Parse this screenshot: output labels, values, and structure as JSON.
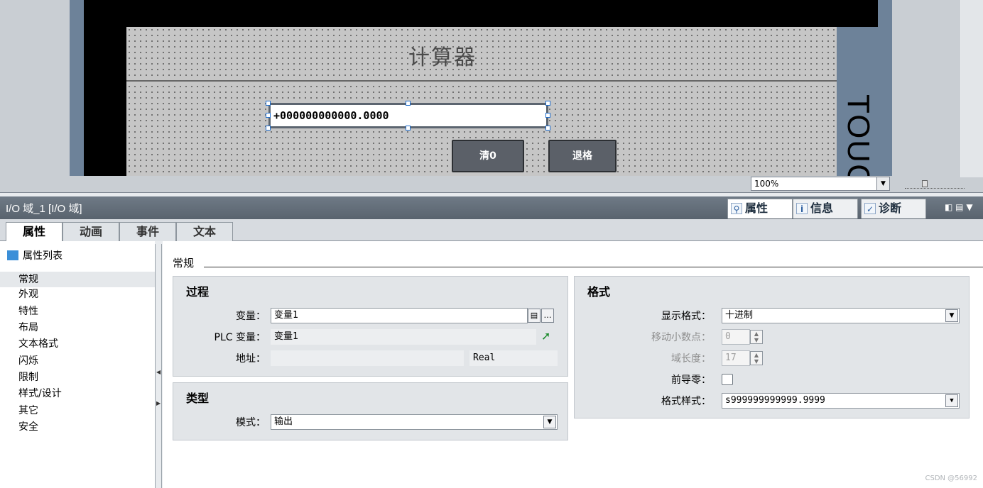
{
  "hmi": {
    "title": "计算器",
    "io_value": "+000000000000.0000",
    "btn_clear": "清0",
    "btn_backspace": "退格",
    "device_label": "TOUCH"
  },
  "editor": {
    "zoom": "100%"
  },
  "property_panel": {
    "title": "I/O 域_1 [I/O 域]",
    "tabs": [
      {
        "label": "属性",
        "icon": "properties-icon"
      },
      {
        "label": "信息",
        "icon": "info-icon"
      },
      {
        "label": "诊断",
        "icon": "diagnostics-icon"
      }
    ],
    "sub_tabs": [
      "属性",
      "动画",
      "事件",
      "文本"
    ]
  },
  "nav": {
    "header": "属性列表",
    "items": [
      "常规",
      "外观",
      "特性",
      "布局",
      "文本格式",
      "闪烁",
      "限制",
      "样式/设计",
      "其它",
      "安全"
    ]
  },
  "general": {
    "section_title": "常规",
    "process": {
      "title": "过程",
      "variable_label": "变量：",
      "variable_value": "变量1",
      "plc_variable_label": "PLC 变量：",
      "plc_variable_value": "变量1",
      "address_label": "地址：",
      "address_value": "",
      "address_type": "Real"
    },
    "type": {
      "title": "类型",
      "mode_label": "模式：",
      "mode_value": "输出"
    },
    "format": {
      "title": "格式",
      "display_format_label": "显示格式：",
      "display_format_value": "十进制",
      "move_decimal_label": "移动小数点：",
      "move_decimal_value": "0",
      "field_length_label": "域长度：",
      "field_length_value": "17",
      "leading_zero_label": "前导零：",
      "leading_zero_checked": false,
      "format_pattern_label": "格式样式：",
      "format_pattern_value": "s999999999999.9999"
    }
  },
  "watermark": "CSDN @56992"
}
